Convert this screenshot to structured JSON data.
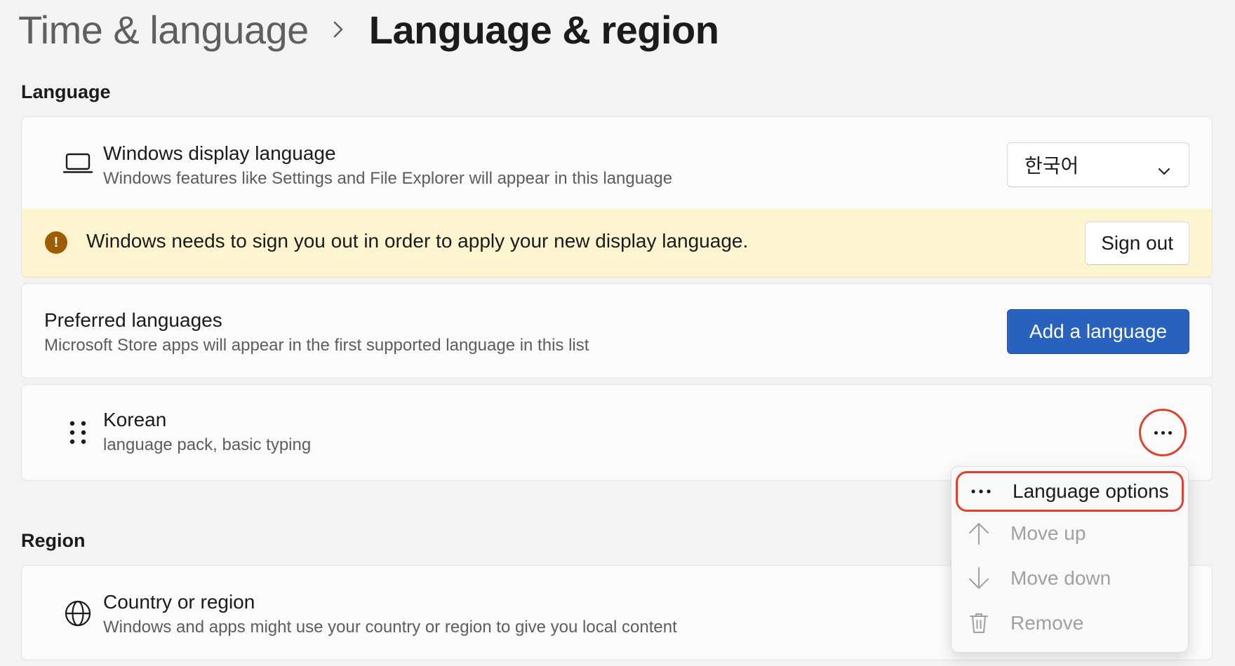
{
  "breadcrumb": {
    "parent": "Time & language",
    "current": "Language & region"
  },
  "language_section": {
    "title": "Language",
    "display_language": {
      "icon": "laptop-icon",
      "title": "Windows display language",
      "subtitle": "Windows features like Settings and File Explorer will appear in this language",
      "selected": "한국어"
    },
    "notice": {
      "icon": "warning-icon",
      "text": "Windows needs to sign you out in order to apply your new display language.",
      "button": "Sign out",
      "color": "#fef4d0"
    },
    "preferred": {
      "title": "Preferred languages",
      "subtitle": "Microsoft Store apps will appear in the first supported language in this list",
      "button": "Add a language",
      "accent_color": "#2861be"
    },
    "languages": [
      {
        "name": "Korean",
        "details": "language pack, basic typing"
      }
    ]
  },
  "context_menu": {
    "items": [
      {
        "icon": "more-icon",
        "label": "Language options",
        "enabled": true
      },
      {
        "icon": "arrow-up-icon",
        "label": "Move up",
        "enabled": false
      },
      {
        "icon": "arrow-down-icon",
        "label": "Move down",
        "enabled": false
      },
      {
        "icon": "trash-icon",
        "label": "Remove",
        "enabled": false
      }
    ],
    "highlight_color": "#e0412c"
  },
  "region_section": {
    "title": "Region",
    "country": {
      "icon": "globe-icon",
      "title": "Country or region",
      "subtitle": "Windows and apps might use your country or region to give you local content"
    }
  }
}
